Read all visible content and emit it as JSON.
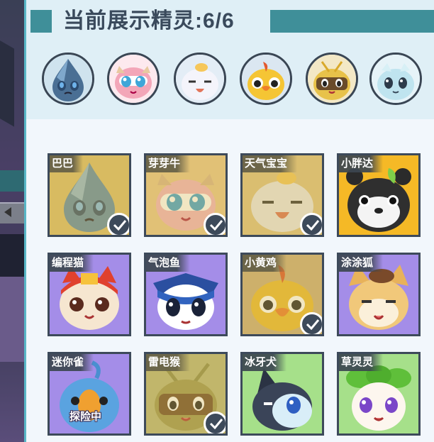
{
  "title": "当前展示精灵:6/6",
  "colors": {
    "accent_teal": "#3f8f99",
    "border_dark": "#3d4a5a",
    "selected_gold": "#d6b650"
  },
  "showcase": [
    {
      "name": "巴巴",
      "icon": "water-drop-creature"
    },
    {
      "name": "芽芽牛",
      "icon": "pink-calf-creature"
    },
    {
      "name": "天气宝宝",
      "icon": "cloud-egg-creature"
    },
    {
      "name": "小黄鸡",
      "icon": "yellow-chick-creature"
    },
    {
      "name": "雷电猴",
      "icon": "thunder-monkey-creature"
    },
    {
      "name": "冰牙犬",
      "icon": "ice-puppy-creature"
    }
  ],
  "pets": [
    {
      "name": "巴巴",
      "selected": true,
      "status": ""
    },
    {
      "name": "芽芽牛",
      "selected": true,
      "status": ""
    },
    {
      "name": "天气宝宝",
      "selected": true,
      "status": ""
    },
    {
      "name": "小胖达",
      "selected": false,
      "status": ""
    },
    {
      "name": "编程猫",
      "selected": false,
      "status": ""
    },
    {
      "name": "气泡鱼",
      "selected": false,
      "status": ""
    },
    {
      "name": "小黄鸡",
      "selected": true,
      "status": ""
    },
    {
      "name": "涂涂狐",
      "selected": false,
      "status": ""
    },
    {
      "name": "迷你雀",
      "selected": false,
      "status": "探险中"
    },
    {
      "name": "雷电猴",
      "selected": true,
      "status": ""
    },
    {
      "name": "冰牙犬",
      "selected": false,
      "status": ""
    },
    {
      "name": "草灵灵",
      "selected": false,
      "status": ""
    }
  ]
}
